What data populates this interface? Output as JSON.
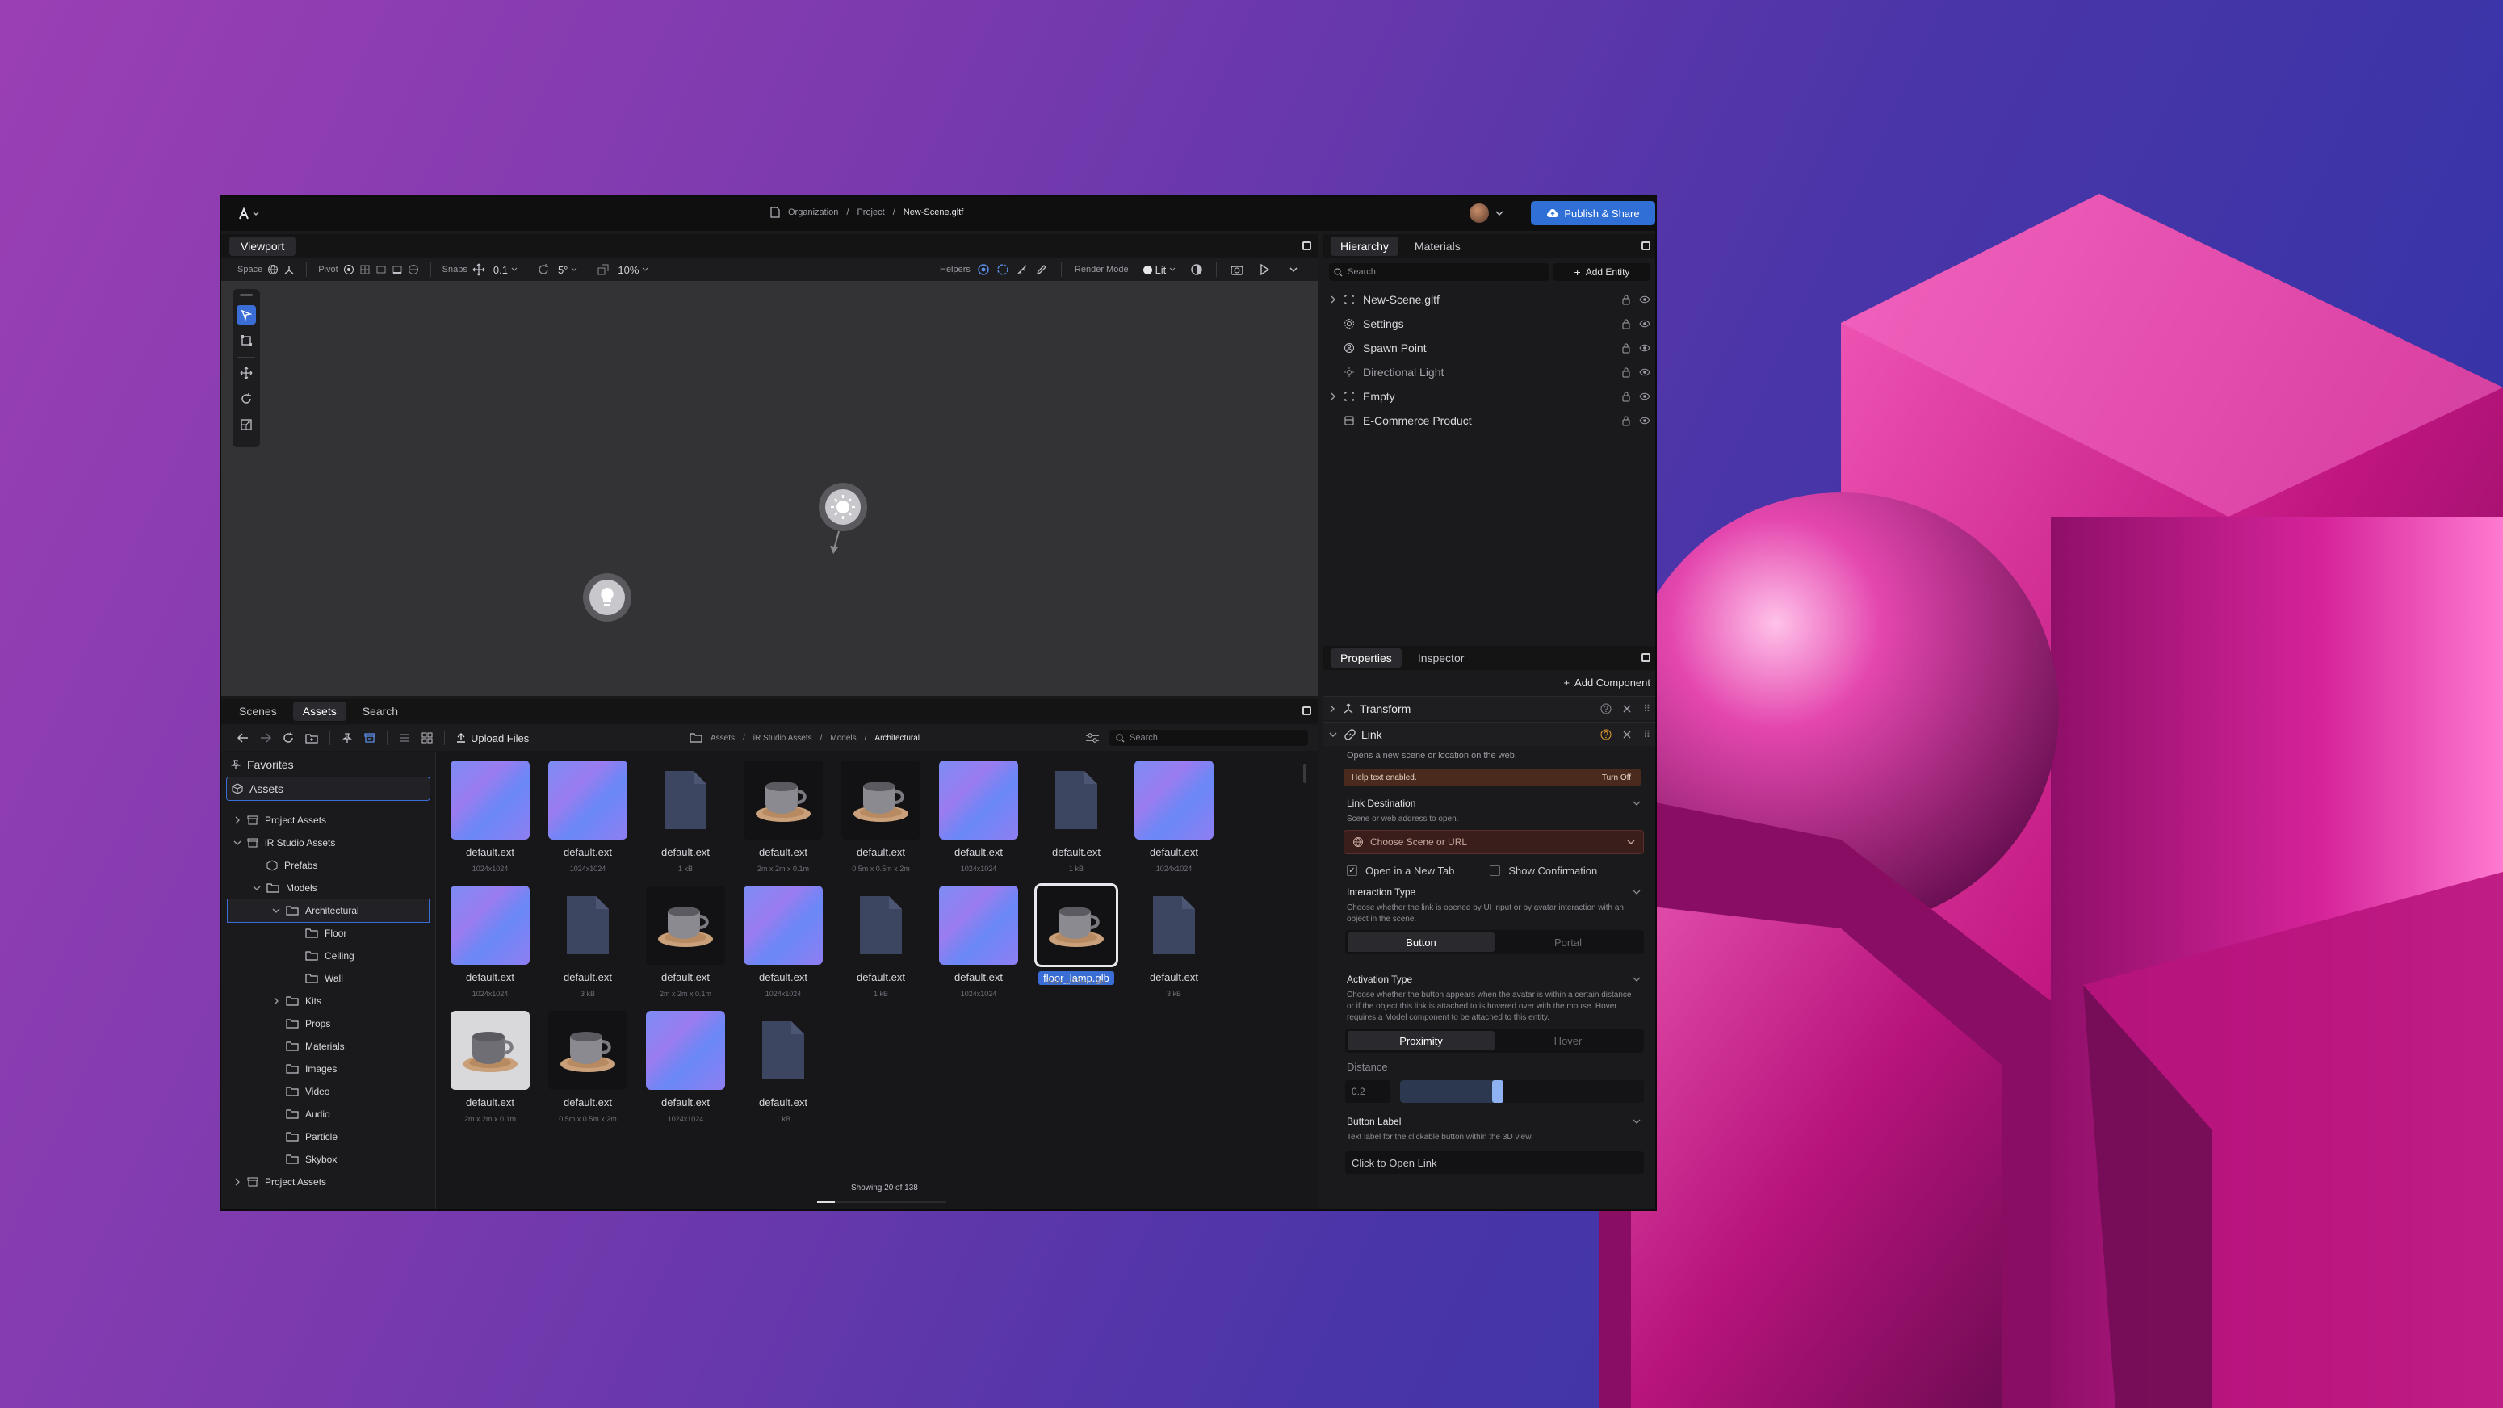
{
  "topbar": {
    "breadcrumb": [
      "Organization",
      "Project",
      "New-Scene.gltf"
    ],
    "publish_label": "Publish & Share"
  },
  "viewport": {
    "tab_label": "Viewport",
    "toolbar": {
      "space_label": "Space",
      "pivot_label": "Pivot",
      "snaps_label": "Snaps",
      "snap_value": "0.1",
      "rotate_value": "5°",
      "scale_value": "10%",
      "helpers_label": "Helpers",
      "render_mode_label": "Render Mode",
      "render_mode_value": "Lit"
    }
  },
  "hierarchy": {
    "tabs": [
      "Hierarchy",
      "Materials"
    ],
    "search_placeholder": "Search",
    "add_entity_label": "Add Entity",
    "items": [
      {
        "label": "New-Scene.gltf",
        "icon": "scene-icon"
      },
      {
        "label": "Settings",
        "icon": "gear-icon"
      },
      {
        "label": "Spawn Point",
        "icon": "spawn-icon"
      },
      {
        "label": "Directional Light",
        "icon": "light-icon"
      },
      {
        "label": "Empty",
        "icon": "empty-icon"
      },
      {
        "label": "E-Commerce Product",
        "icon": "product-icon"
      }
    ]
  },
  "properties": {
    "tabs": [
      "Properties",
      "Inspector"
    ],
    "add_component_label": "Add Component",
    "transform_label": "Transform",
    "link_label": "Link",
    "link_desc": "Opens a new scene or location on the web.",
    "help_text": "Help text enabled.",
    "turn_off": "Turn Off",
    "link_destination_label": "Link Destination",
    "link_destination_desc": "Scene or web address to open.",
    "choose_placeholder": "Choose Scene or URL",
    "open_new_tab": "Open in a New Tab",
    "show_confirmation": "Show Confirmation",
    "interaction_type_label": "Interaction Type",
    "interaction_type_desc": "Choose whether the link is opened by UI input or by avatar interaction with an object in the scene.",
    "interaction_options": [
      "Button",
      "Portal"
    ],
    "activation_type_label": "Activation Type",
    "activation_type_desc": "Choose whether the button appears when the avatar is within a certain distance or if the object this link is attached to is hovered over with the mouse. Hover requires a Model component to be attached to this entity.",
    "activation_options": [
      "Proximity",
      "Hover"
    ],
    "distance_label": "Distance",
    "distance_value": "0.2",
    "distance_fraction": 0.4,
    "button_label_label": "Button Label",
    "button_label_desc": "Text label for the clickable button within the 3D view.",
    "button_label_value": "Click to Open Link"
  },
  "assets_panel": {
    "tabs": [
      "Scenes",
      "Assets",
      "Search"
    ],
    "upload_label": "Upload Files",
    "path": [
      "Assets",
      "iR Studio Assets",
      "Models",
      "Architectural"
    ],
    "search_placeholder": "Search",
    "showing": "Showing 20 of 138",
    "sidebar": {
      "favorites": "Favorites",
      "assets": "Assets",
      "tree": [
        {
          "label": "Project Assets",
          "indent": 0,
          "arrow": "right"
        },
        {
          "label": "iR Studio Assets",
          "indent": 0,
          "arrow": "down"
        },
        {
          "label": "Prefabs",
          "indent": 1,
          "arrow": ""
        },
        {
          "label": "Models",
          "indent": 1,
          "arrow": "down"
        },
        {
          "label": "Architectural",
          "indent": 2,
          "arrow": "down"
        },
        {
          "label": "Floor",
          "indent": 3,
          "arrow": ""
        },
        {
          "label": "Ceiling",
          "indent": 3,
          "arrow": ""
        },
        {
          "label": "Wall",
          "indent": 3,
          "arrow": ""
        },
        {
          "label": "Kits",
          "indent": 2,
          "arrow": "right"
        },
        {
          "label": "Props",
          "indent": 2,
          "arrow": ""
        },
        {
          "label": "Materials",
          "indent": 2,
          "arrow": ""
        },
        {
          "label": "Images",
          "indent": 2,
          "arrow": ""
        },
        {
          "label": "Video",
          "indent": 2,
          "arrow": ""
        },
        {
          "label": "Audio",
          "indent": 2,
          "arrow": ""
        },
        {
          "label": "Particle",
          "indent": 2,
          "arrow": ""
        },
        {
          "label": "Skybox",
          "indent": 2,
          "arrow": ""
        },
        {
          "label": "Project Assets",
          "indent": 0,
          "arrow": "right"
        }
      ]
    },
    "items": [
      {
        "name": "default.ext",
        "sub": "1024x1024",
        "kind": "normal"
      },
      {
        "name": "default.ext",
        "sub": "1024x1024",
        "kind": "normal"
      },
      {
        "name": "default.ext",
        "sub": "1 kB",
        "kind": "file"
      },
      {
        "name": "default.ext",
        "sub": "2m x 2m x 0.1m",
        "kind": "mug"
      },
      {
        "name": "default.ext",
        "sub": "0.5m x 0.5m x 2m",
        "kind": "mug"
      },
      {
        "name": "default.ext",
        "sub": "1024x1024",
        "kind": "normal"
      },
      {
        "name": "default.ext",
        "sub": "1 kB",
        "kind": "file"
      },
      {
        "name": "default.ext",
        "sub": "1024x1024",
        "kind": "normal"
      },
      {
        "name": "default.ext",
        "sub": "1024x1024",
        "kind": "normal"
      },
      {
        "name": "default.ext",
        "sub": "3 kB",
        "kind": "file"
      },
      {
        "name": "default.ext",
        "sub": "2m x 2m x 0.1m",
        "kind": "mug"
      },
      {
        "name": "default.ext",
        "sub": "1024x1024",
        "kind": "normal"
      },
      {
        "name": "default.ext",
        "sub": "1 kB",
        "kind": "file"
      },
      {
        "name": "default.ext",
        "sub": "1024x1024",
        "kind": "normal"
      },
      {
        "name": "floor_lamp.glb",
        "sub": "0.5m x 0.5m x 2m",
        "kind": "mug",
        "selected": true
      },
      {
        "name": "default.ext",
        "sub": "3 kB",
        "kind": "file"
      },
      {
        "name": "default.ext",
        "sub": "2m x 2m x 0.1m",
        "kind": "mug-light"
      },
      {
        "name": "default.ext",
        "sub": "0.5m x 0.5m x 2m",
        "kind": "mug"
      },
      {
        "name": "default.ext",
        "sub": "1024x1024",
        "kind": "normal"
      },
      {
        "name": "default.ext",
        "sub": "1 kB",
        "kind": "file"
      }
    ]
  },
  "colors": {
    "accent": "#3a6ed6",
    "publish_bg": "#2f6fd6",
    "bg_gradient_start": "#9b3fb4",
    "bg_gradient_end": "#2b34a8",
    "deco_magenta": "#d01f8c"
  }
}
